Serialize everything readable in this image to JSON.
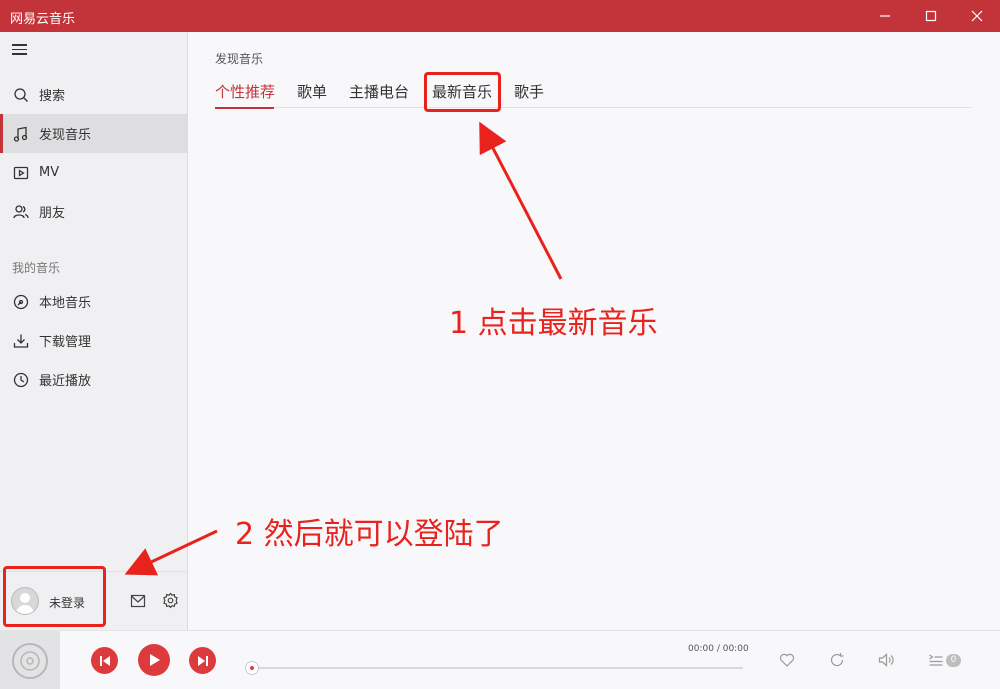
{
  "window": {
    "title": "网易云音乐"
  },
  "sidebar": {
    "items": [
      {
        "label": "搜索",
        "icon": "search-icon"
      },
      {
        "label": "发现音乐",
        "icon": "music-note-icon",
        "active": true
      },
      {
        "label": "MV",
        "icon": "video-icon"
      },
      {
        "label": "朋友",
        "icon": "friends-icon"
      }
    ],
    "section_label": "我的音乐",
    "my_music": [
      {
        "label": "本地音乐",
        "icon": "local-disc-icon"
      },
      {
        "label": "下载管理",
        "icon": "download-icon"
      },
      {
        "label": "最近播放",
        "icon": "clock-icon"
      }
    ],
    "user": {
      "name": "未登录"
    }
  },
  "main": {
    "breadcrumb": "发现音乐",
    "tabs": [
      "个性推荐",
      "歌单",
      "主播电台",
      "最新音乐",
      "歌手"
    ],
    "active_tab": "个性推荐"
  },
  "annotations": {
    "step1": "1 点击最新音乐",
    "step2": "2 然后就可以登陆了",
    "color": "#e8231e"
  },
  "player": {
    "current_time": "00:00",
    "separator": "/",
    "total_time": "00:00",
    "progress": 0,
    "queue_count": "0"
  },
  "colors": {
    "accent": "#c3343a",
    "play_button": "#dd3a3e"
  }
}
